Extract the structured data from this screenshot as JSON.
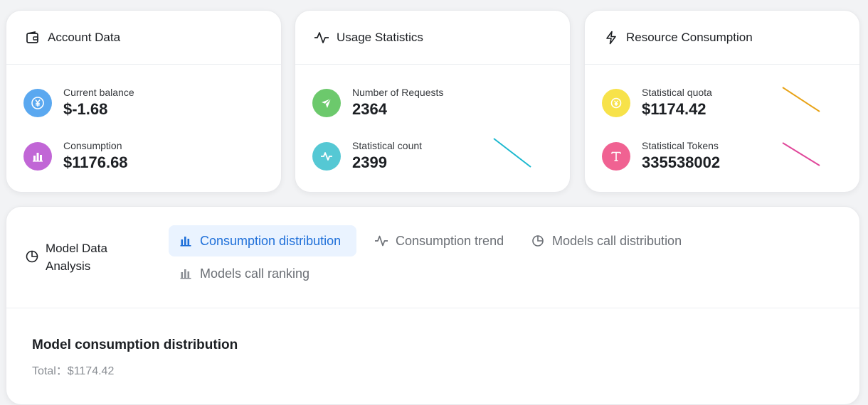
{
  "colors": {
    "balance": "#5aa8f0",
    "consumption": "#c166d6",
    "requests": "#6cc96c",
    "stat_count": "#55c8d4",
    "quota": "#f7e24a",
    "tokens": "#f06292",
    "spark_cyan": "#1bb8cf",
    "spark_orange": "#e8a317",
    "spark_pink": "#e0479a",
    "tab_active": "#1e6fd9"
  },
  "account": {
    "title": "Account Data",
    "icon": "wallet-icon",
    "balance_label": "Current balance",
    "balance_value": "$-1.68",
    "consumption_label": "Consumption",
    "consumption_value": "$1176.68"
  },
  "usage": {
    "title": "Usage Statistics",
    "icon": "activity-icon",
    "requests_label": "Number of Requests",
    "requests_value": "2364",
    "count_label": "Statistical count",
    "count_value": "2399"
  },
  "resource": {
    "title": "Resource Consumption",
    "icon": "lightning-icon",
    "quota_label": "Statistical quota",
    "quota_value": "$1174.42",
    "tokens_label": "Statistical Tokens",
    "tokens_value": "335538002"
  },
  "analysis": {
    "title_line1": "Model Data",
    "title_line2": "Analysis",
    "tabs": [
      {
        "label": "Consumption distribution",
        "icon": "bar-chart-icon",
        "active": true
      },
      {
        "label": "Consumption trend",
        "icon": "activity-icon",
        "active": false
      },
      {
        "label": "Models call distribution",
        "icon": "pie-chart-icon",
        "active": false
      },
      {
        "label": "Models call ranking",
        "icon": "bar-chart-icon",
        "active": false
      }
    ],
    "chart_title": "Model consumption distribution",
    "total_text": "Total：$1174.42"
  }
}
